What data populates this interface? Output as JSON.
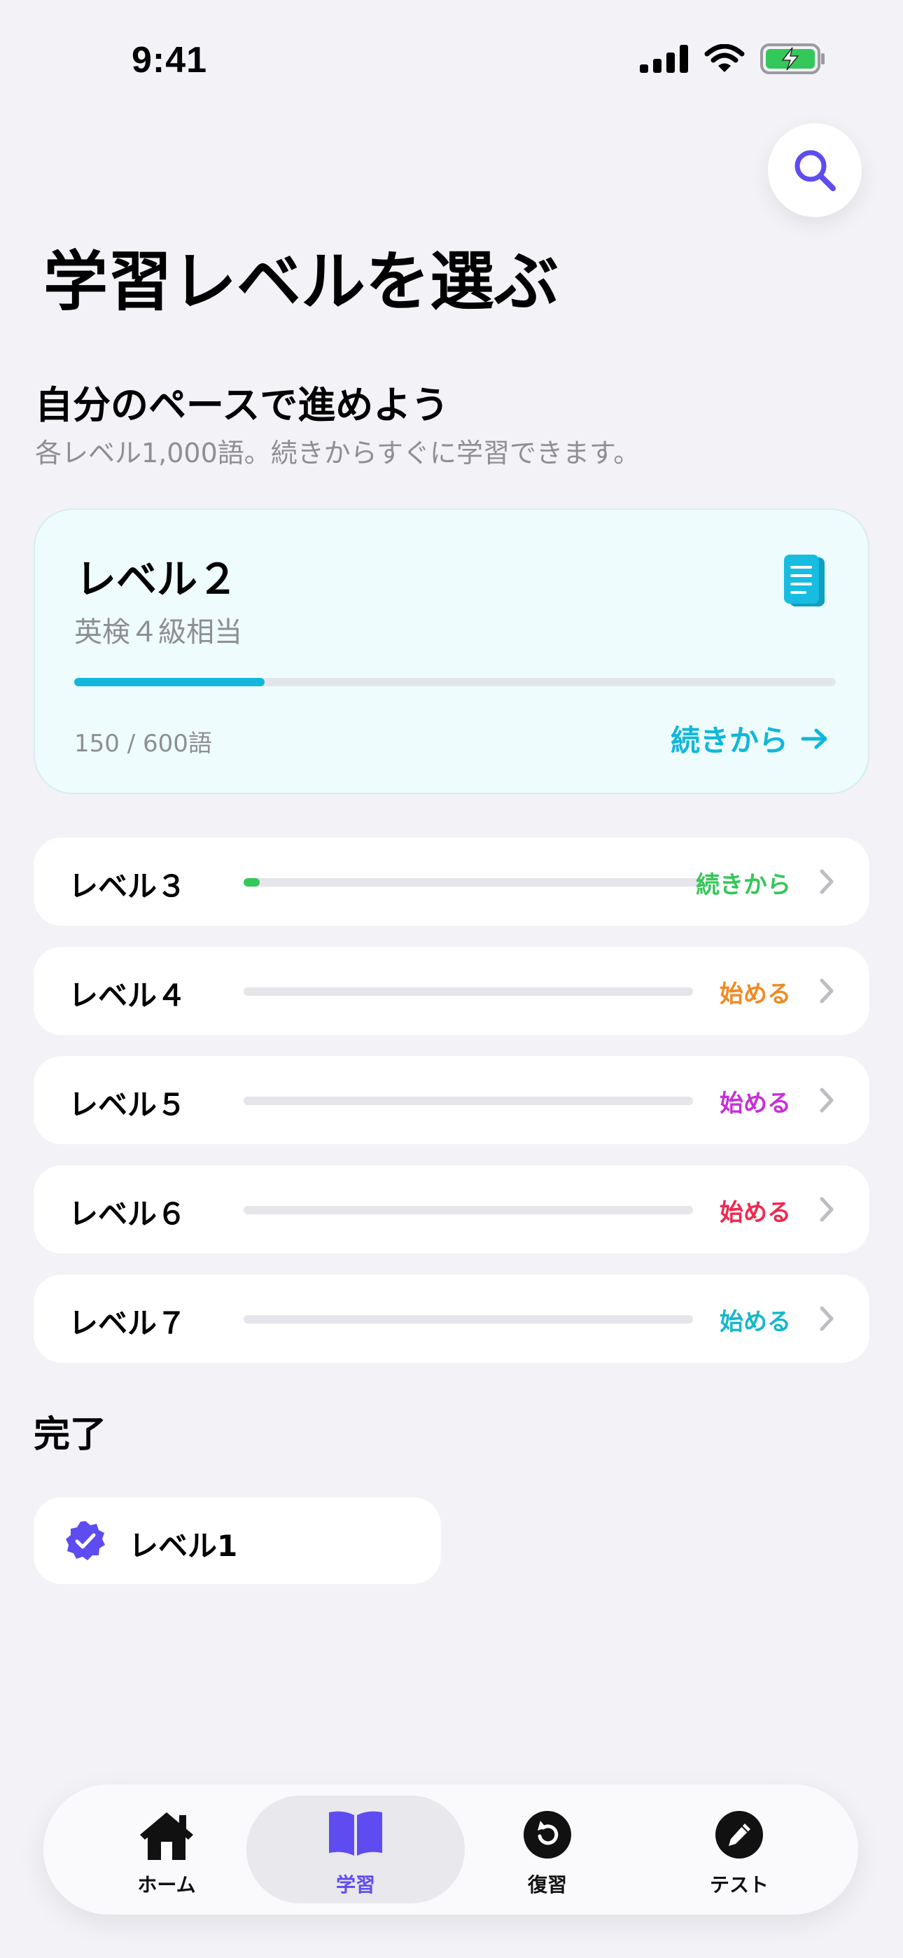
{
  "status_bar": {
    "time": "9:41"
  },
  "header": {
    "title": "学習レベルを選ぶ",
    "subtitle": "自分のペースで進めよう",
    "description": "各レベル1,000語。続きからすぐに学習できます。"
  },
  "featured": {
    "level": "レベル２",
    "equivalent": "英検４級相当",
    "count_text": "150 / 600語",
    "progress": 0.25,
    "action": "続きから",
    "accent": "#10B7DB",
    "icon": "notebook-icon"
  },
  "levels": [
    {
      "label": "レベル３",
      "action": "続きから",
      "progress": 0.035,
      "color": "#34C759"
    },
    {
      "label": "レベル４",
      "action": "始める",
      "progress": 0,
      "color": "#F08A24"
    },
    {
      "label": "レベル５",
      "action": "始める",
      "progress": 0,
      "color": "#C72FD9"
    },
    {
      "label": "レベル６",
      "action": "始める",
      "progress": 0,
      "color": "#F0284F"
    },
    {
      "label": "レベル７",
      "action": "始める",
      "progress": 0,
      "color": "#14B8C9"
    }
  ],
  "completed": {
    "heading": "完了",
    "items": [
      {
        "label": "レベル1",
        "icon": "verified-badge-icon",
        "color": "#5E4CF0"
      }
    ]
  },
  "tabbar": {
    "active_color": "#5E4CF0",
    "tabs": [
      {
        "label": "ホーム",
        "icon": "home-icon",
        "active": false
      },
      {
        "label": "学習",
        "icon": "open-book-icon",
        "active": true
      },
      {
        "label": "復習",
        "icon": "review-icon",
        "active": false
      },
      {
        "label": "テスト",
        "icon": "pencil-icon",
        "active": false
      }
    ]
  }
}
